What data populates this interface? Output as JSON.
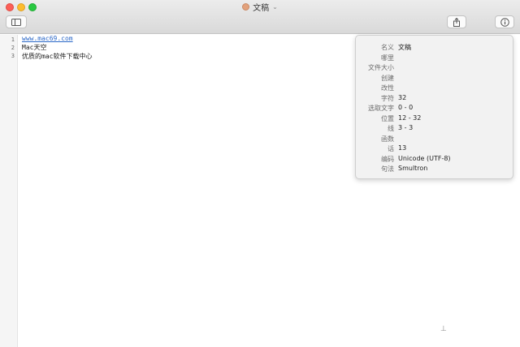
{
  "window": {
    "title": "文稿",
    "icons": {
      "doc": "document-icon",
      "chevron": "chevron-down-icon",
      "sidebar": "sidebar-icon",
      "share": "share-icon",
      "info": "info-icon"
    }
  },
  "editor": {
    "lines": [
      {
        "number": "1",
        "text": "www.mac69.com"
      },
      {
        "number": "2",
        "text": "Mac天空"
      },
      {
        "number": "3",
        "text": "优质的mac软件下载中心"
      }
    ]
  },
  "info_panel": {
    "rows": [
      {
        "label": "名义",
        "value": "文稿"
      },
      {
        "label": "哪里",
        "value": ""
      },
      {
        "label": "文件大小",
        "value": ""
      },
      {
        "label": "创建",
        "value": ""
      },
      {
        "label": "改性",
        "value": ""
      },
      {
        "label": "字符",
        "value": "32"
      },
      {
        "label": "选取文字",
        "value": "0 - 0"
      },
      {
        "label": "位置",
        "value": "12 - 32"
      },
      {
        "label": "线",
        "value": "3 - 3"
      },
      {
        "label": "函数",
        "value": ""
      },
      {
        "label": "话",
        "value": "13"
      },
      {
        "label": "编码",
        "value": "Unicode (UTF-8)"
      },
      {
        "label": "句法",
        "value": "Smultron"
      }
    ]
  }
}
